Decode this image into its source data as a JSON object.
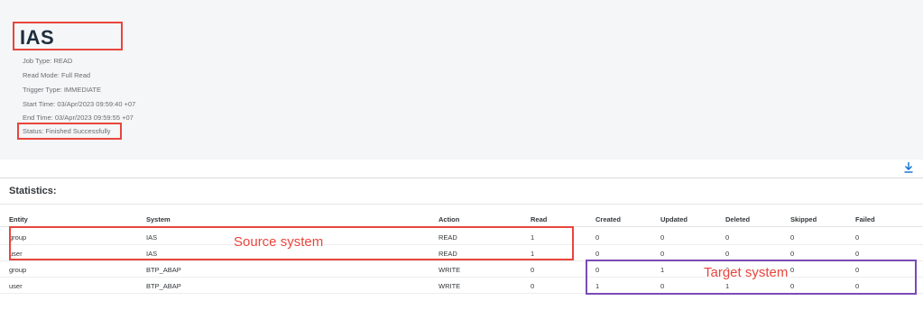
{
  "job": {
    "title": "IAS",
    "job_type": "Job Type: READ",
    "read_mode": "Read Mode: Full Read",
    "trigger_type": "Trigger Type: IMMEDIATE",
    "start_time": "Start Time: 03/Apr/2023 09:59:40 +07",
    "end_time": "End Time: 03/Apr/2023 09:59:55 +07",
    "status": "Status: Finished Successfully"
  },
  "toolbar": {
    "download_icon": "download-icon"
  },
  "statistics": {
    "title": "Statistics:",
    "columns": [
      "Entity",
      "System",
      "Action",
      "Read",
      "Created",
      "Updated",
      "Deleted",
      "Skipped",
      "Failed"
    ],
    "rows": [
      [
        "group",
        "IAS",
        "READ",
        "1",
        "0",
        "0",
        "0",
        "0",
        "0"
      ],
      [
        "user",
        "IAS",
        "READ",
        "1",
        "0",
        "0",
        "0",
        "0",
        "0"
      ],
      [
        "group",
        "BTP_ABAP",
        "WRITE",
        "0",
        "0",
        "1",
        "0",
        "0",
        "0"
      ],
      [
        "user",
        "BTP_ABAP",
        "WRITE",
        "0",
        "1",
        "0",
        "1",
        "0",
        "0"
      ]
    ]
  },
  "annotations": {
    "source": "Source system",
    "target": "Target system",
    "highlight_color": "#e8453c",
    "target_box_color": "#7a4bb5"
  }
}
